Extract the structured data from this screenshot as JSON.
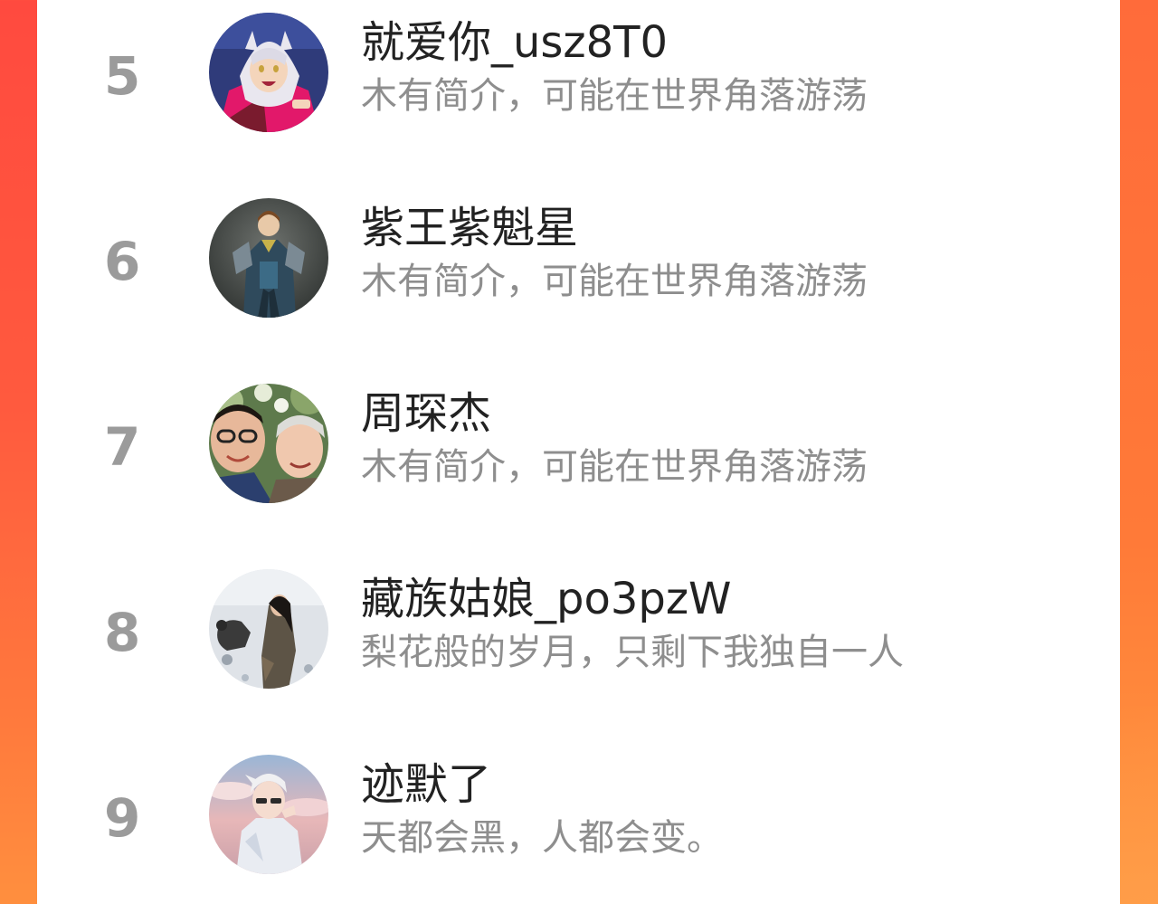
{
  "colors": {
    "background_accent": "#ff5a3e",
    "panel": "#ffffff",
    "rank_number": "#9b9b9b",
    "username": "#222222",
    "bio": "#8e8e8e"
  },
  "ranking": [
    {
      "rank": "5",
      "username": "就爱你_usz8T0",
      "bio": "木有简介，可能在世界角落游荡",
      "avatar_icon": "anime-character-avatar"
    },
    {
      "rank": "6",
      "username": "紫王紫魁星",
      "bio": "木有简介，可能在世界角落游荡",
      "avatar_icon": "armored-warrior-avatar"
    },
    {
      "rank": "7",
      "username": "周琛杰",
      "bio": "木有简介，可能在世界角落游荡",
      "avatar_icon": "selfie-photo-avatar"
    },
    {
      "rank": "8",
      "username": "藏族姑娘_po3pzW",
      "bio": "梨花般的岁月，只剩下我独自一人",
      "avatar_icon": "snow-scene-avatar"
    },
    {
      "rank": "9",
      "username": "迹默了",
      "bio": "天都会黑，人都会变。",
      "avatar_icon": "illustrated-boy-avatar"
    }
  ]
}
